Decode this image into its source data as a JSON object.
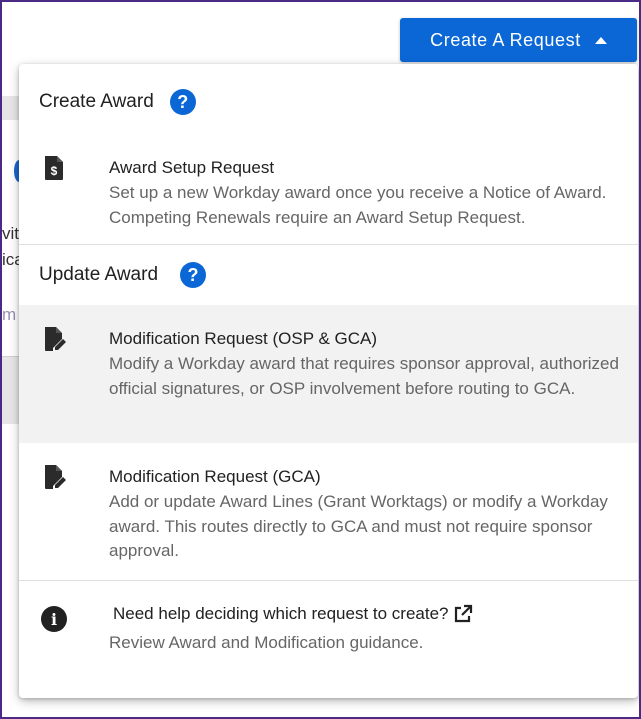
{
  "background": {
    "line1": "vit",
    "line2": "ica",
    "line3": "m"
  },
  "create_button": {
    "label": "Create A Request"
  },
  "menu": {
    "create_section": {
      "title": "Create Award",
      "items": [
        {
          "icon": "dollar-document-icon",
          "title": "Award Setup Request",
          "description": "Set up a new Workday award once you receive a Notice of Award. Competing Renewals require an Award Setup Request."
        }
      ]
    },
    "update_section": {
      "title": "Update Award",
      "items": [
        {
          "icon": "edit-document-icon",
          "title": "Modification Request (OSP & GCA)",
          "description": "Modify a Workday award that requires sponsor approval, authorized official signatures, or OSP involvement before routing to GCA."
        },
        {
          "icon": "edit-document-icon",
          "title": "Modification Request (GCA)",
          "description": "Add or update Award Lines (Grant Worktags) or modify a Workday award. This routes directly to GCA and must not require sponsor approval."
        }
      ]
    },
    "help": {
      "link_text": "Need help deciding which request to create?",
      "subtext": "Review Award and Modification guidance."
    }
  },
  "colors": {
    "primary": "#0b67d6",
    "text": "#212121",
    "muted": "#666666",
    "highlight": "#f2f2f2",
    "frame": "#4b2a86"
  }
}
